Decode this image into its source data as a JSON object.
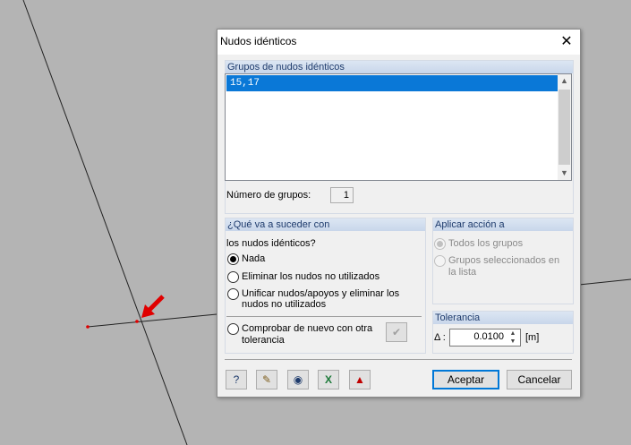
{
  "dialog": {
    "title": "Nudos idénticos",
    "close_glyph": "✕"
  },
  "groups_panel": {
    "header": "Grupos de nudos idénticos",
    "items": [
      "15,17"
    ],
    "count_label": "Número de grupos:",
    "count_value": "1"
  },
  "what_panel": {
    "header": "¿Qué va a suceder con",
    "subheader": "los nudos idénticos?",
    "options": [
      {
        "label": "Nada",
        "selected": true
      },
      {
        "label": "Eliminar los nudos no utilizados",
        "selected": false
      },
      {
        "label": "Unificar nudos/apoyos y eliminar los nudos no utilizados",
        "selected": false
      },
      {
        "label": "Comprobar de nuevo con otra tolerancia",
        "selected": false
      }
    ]
  },
  "apply_panel": {
    "header": "Aplicar acción a",
    "options": [
      {
        "label": "Todos los grupos",
        "selected": true,
        "enabled": false
      },
      {
        "label": "Grupos seleccionados en la lista",
        "selected": false,
        "enabled": false
      }
    ]
  },
  "tolerance_panel": {
    "header": "Tolerancia",
    "delta_label": "Δ :",
    "value": "0.0100",
    "unit": "[m]"
  },
  "footer": {
    "tool_icons": [
      "help-icon",
      "notes-icon",
      "view-icon",
      "excel-export-icon",
      "nodes-icon"
    ],
    "accept_label": "Aceptar",
    "cancel_label": "Cancelar"
  },
  "colors": {
    "background": "#b4b4b4",
    "selection": "#0a78d7",
    "panel_header": "#dce6f3",
    "marker": "#e00000"
  }
}
